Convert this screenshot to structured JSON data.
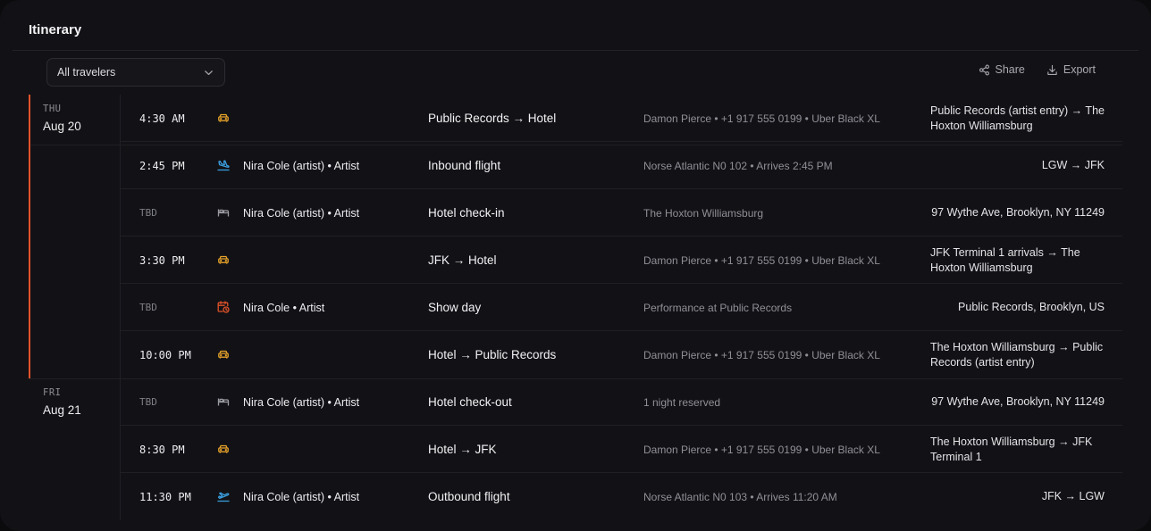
{
  "header": {
    "title": "Itinerary"
  },
  "toolbar": {
    "traveler_filter": "All travelers",
    "share_label": "Share",
    "export_label": "Export"
  },
  "days": [
    {
      "dow": "THU",
      "date": "Aug 20",
      "active": true,
      "rows": [
        {
          "time": "4:30 AM",
          "tbd": false,
          "icon": "car-icon",
          "traveler": "",
          "event": "Public Records → Hotel",
          "detail": "Damon Pierce • +1 917 555 0199 • Uber Black XL",
          "location": "Public Records (artist entry) → The Hoxton Williamsburg",
          "location_align": "left"
        },
        {
          "time": "2:45 PM",
          "tbd": false,
          "icon": "flight-landing-icon",
          "traveler": "Nira Cole (artist) • Artist",
          "event": "Inbound flight",
          "detail": "Norse Atlantic N0 102 • Arrives 2:45 PM",
          "location": "LGW → JFK",
          "location_align": "right"
        },
        {
          "time": "TBD",
          "tbd": true,
          "icon": "bed-icon",
          "traveler": "Nira Cole (artist) • Artist",
          "event": "Hotel check-in",
          "detail": "The Hoxton Williamsburg",
          "location": "97 Wythe Ave, Brooklyn, NY 11249",
          "location_align": "right"
        },
        {
          "time": "3:30 PM",
          "tbd": false,
          "icon": "car-icon",
          "traveler": "",
          "event": "JFK → Hotel",
          "detail": "Damon Pierce • +1 917 555 0199 • Uber Black XL",
          "location": "JFK Terminal 1 arrivals → The Hoxton Williamsburg",
          "location_align": "left"
        },
        {
          "time": "TBD",
          "tbd": true,
          "icon": "calendar-clock-icon",
          "traveler": "Nira Cole • Artist",
          "event": "Show day",
          "detail": "Performance at Public Records",
          "location": "Public Records, Brooklyn, US",
          "location_align": "right"
        },
        {
          "time": "10:00 PM",
          "tbd": false,
          "icon": "car-icon",
          "traveler": "",
          "event": "Hotel → Public Records",
          "detail": "Damon Pierce • +1 917 555 0199 • Uber Black XL",
          "location": "The Hoxton Williamsburg → Public Records (artist entry)",
          "location_align": "left"
        }
      ]
    },
    {
      "dow": "FRI",
      "date": "Aug 21",
      "active": false,
      "rows": [
        {
          "time": "TBD",
          "tbd": true,
          "icon": "bed-icon",
          "traveler": "Nira Cole (artist) • Artist",
          "event": "Hotel check-out",
          "detail": "1 night reserved",
          "location": "97 Wythe Ave, Brooklyn, NY 11249",
          "location_align": "right"
        },
        {
          "time": "8:30 PM",
          "tbd": false,
          "icon": "car-icon",
          "traveler": "",
          "event": "Hotel → JFK",
          "detail": "Damon Pierce • +1 917 555 0199 • Uber Black XL",
          "location": "The Hoxton Williamsburg → JFK Terminal 1",
          "location_align": "left"
        },
        {
          "time": "11:30 PM",
          "tbd": false,
          "icon": "flight-takeoff-icon",
          "traveler": "Nira Cole (artist) • Artist",
          "event": "Outbound flight",
          "detail": "Norse Atlantic N0 103 • Arrives 11:20 AM",
          "location": "JFK → LGW",
          "location_align": "right"
        }
      ]
    }
  ],
  "colors": {
    "accent": "#e0522a",
    "car": "#e8a32a",
    "flight": "#3b9fe0",
    "bed": "#9a9aa2",
    "show": "#e0522a"
  }
}
